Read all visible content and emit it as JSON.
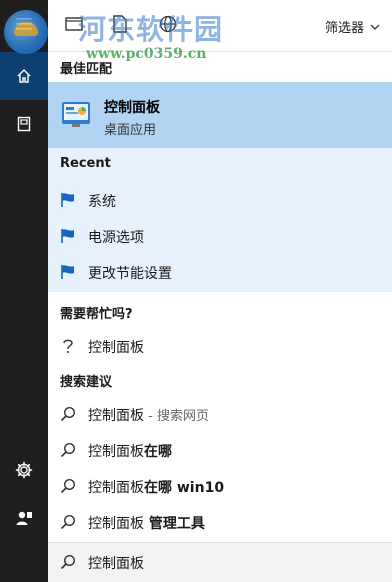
{
  "rail": {
    "items": [
      "hamburger-menu",
      "home",
      "documents",
      "settings",
      "user"
    ]
  },
  "topbar": {
    "filter_label": "筛选器"
  },
  "watermark": {
    "title": "河东软件园",
    "url": "www.pc0359.cn"
  },
  "sections": {
    "best_match": "最佳匹配",
    "recent": "Recent",
    "help": "需要帮忙吗?",
    "suggestions": "搜索建议"
  },
  "best_match": {
    "name": "控制面板",
    "subtitle": "桌面应用"
  },
  "recent": [
    {
      "label": "系统"
    },
    {
      "label": "电源选项"
    },
    {
      "label": "更改节能设置"
    }
  ],
  "help_item": {
    "label": "控制面板"
  },
  "suggestions": [
    {
      "text": "控制面板",
      "suffix": "",
      "hint": " - 搜索网页"
    },
    {
      "text": "控制面板",
      "suffix": "在哪",
      "hint": ""
    },
    {
      "text": "控制面板",
      "suffix": "在哪 win10",
      "hint": ""
    },
    {
      "text": "控制面板",
      "suffix": " 管理工具",
      "hint": ""
    }
  ],
  "search": {
    "query": "控制面板"
  },
  "colors": {
    "rail_bg": "#1f1f1f",
    "rail_active": "#0c3f70",
    "best_match_bg": "#b0d4f1",
    "recent_bg": "#e7f1fb",
    "accent": "#1565c0"
  }
}
